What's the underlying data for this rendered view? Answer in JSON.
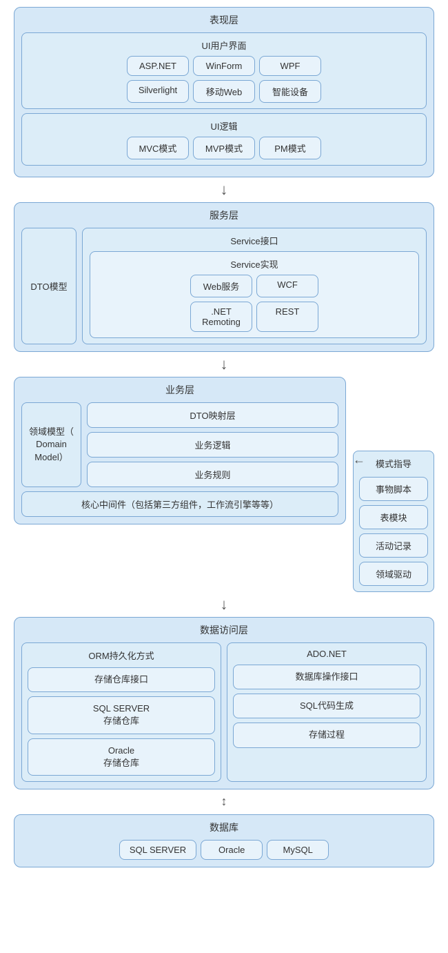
{
  "presentation": {
    "layer_title": "表现层",
    "ui_section": {
      "title": "UI用户界面",
      "items_row1": [
        "ASP.NET",
        "WinForm",
        "WPF"
      ],
      "items_row2": [
        "Silverlight",
        "移动Web",
        "智能设备"
      ]
    },
    "ui_logic": {
      "title": "UI逻辑",
      "items": [
        "MVC模式",
        "MVP模式",
        "PM模式"
      ]
    }
  },
  "service": {
    "layer_title": "服务层",
    "dto": "DTO模型",
    "interface_title": "Service接口",
    "impl": {
      "title": "Service实现",
      "items_row1": [
        "Web服务",
        "WCF"
      ],
      "items_row2": [
        ".NET\nRemoting",
        "REST"
      ]
    }
  },
  "business": {
    "layer_title": "业务层",
    "domain": "领域模型（\nDomain\nModel）",
    "dto_mapping": "DTO映射层",
    "logic": "业务逻辑",
    "rules": "业务规则",
    "middleware": "核心中间件（包括第三方组件，工作流引擎等等）"
  },
  "pattern": {
    "title": "模式指导",
    "items": [
      "事物脚本",
      "表模块",
      "活动记录",
      "领域驱动"
    ]
  },
  "data_access": {
    "layer_title": "数据访问层",
    "orm_col": {
      "title": "ORM持久化方式",
      "items": [
        "存储仓库接口",
        "SQL SERVER\n存储仓库",
        "Oracle\n存储仓库"
      ]
    },
    "ado_col": {
      "title": "ADO.NET",
      "items": [
        "数据库操作接口",
        "SQL代码生成",
        "存储过程"
      ]
    }
  },
  "database": {
    "layer_title": "数据库",
    "items": [
      "SQL SERVER",
      "Oracle",
      "MySQL"
    ]
  },
  "arrows": {
    "down": "↓",
    "both": "↕",
    "left": "←"
  }
}
